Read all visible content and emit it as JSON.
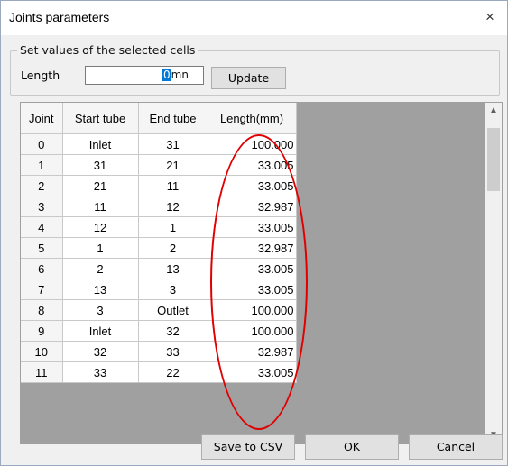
{
  "dialog": {
    "title": "Joints parameters",
    "close_glyph": "×"
  },
  "set_values": {
    "group_label": "Set values of the selected cells",
    "length_label": "Length",
    "input_selected": "0",
    "input_rest": "mn",
    "update_label": "Update"
  },
  "table": {
    "headers": [
      "Joint",
      "Start tube",
      "End tube",
      "Length(mm)"
    ],
    "rows": [
      [
        "0",
        "Inlet",
        "31",
        "100.000"
      ],
      [
        "1",
        "31",
        "21",
        "33.005"
      ],
      [
        "2",
        "21",
        "11",
        "33.005"
      ],
      [
        "3",
        "11",
        "12",
        "32.987"
      ],
      [
        "4",
        "12",
        "1",
        "33.005"
      ],
      [
        "5",
        "1",
        "2",
        "32.987"
      ],
      [
        "6",
        "2",
        "13",
        "33.005"
      ],
      [
        "7",
        "13",
        "3",
        "33.005"
      ],
      [
        "8",
        "3",
        "Outlet",
        "100.000"
      ],
      [
        "9",
        "Inlet",
        "32",
        "100.000"
      ],
      [
        "10",
        "32",
        "33",
        "32.987"
      ],
      [
        "11",
        "33",
        "22",
        "33.005"
      ]
    ]
  },
  "buttons": {
    "save_csv": "Save to CSV",
    "ok": "OK",
    "cancel": "Cancel"
  },
  "colors": {
    "annotation": "#e00000",
    "selection": "#0078d7",
    "grid_background": "#a0a0a0"
  },
  "icons": {
    "close": "close-icon",
    "scroll_up": "chevron-up-icon",
    "scroll_down": "chevron-down-icon"
  }
}
